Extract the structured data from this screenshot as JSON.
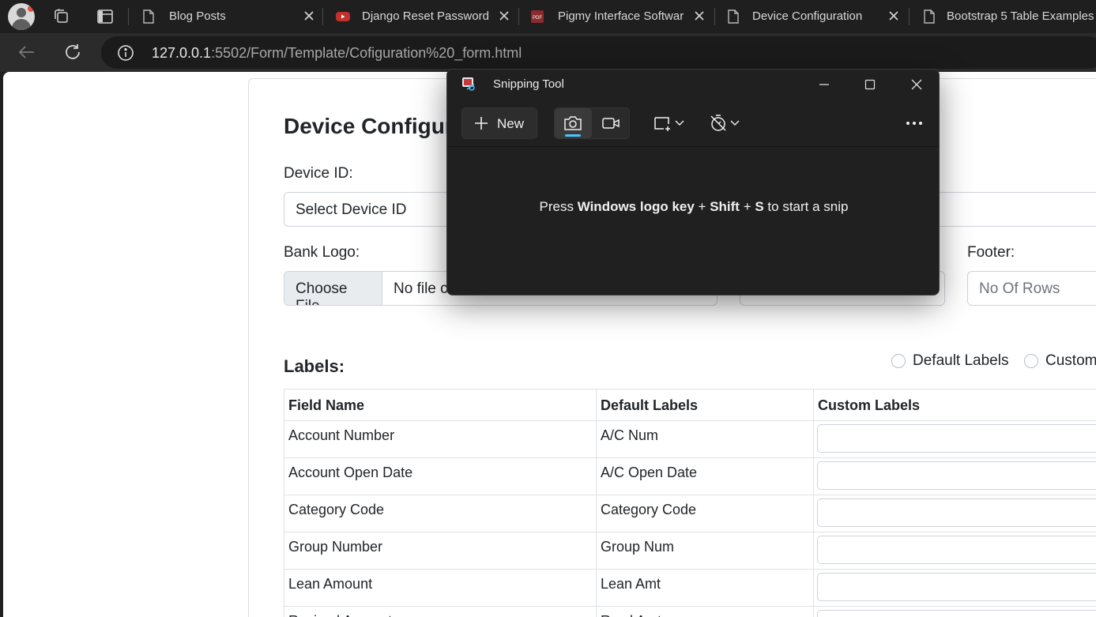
{
  "tabs": [
    {
      "title": "Blog Posts",
      "icon": "document-icon"
    },
    {
      "title": "Django Reset Password",
      "icon": "youtube-icon"
    },
    {
      "title": "Pigmy Interface Software",
      "icon": "pdf-icon"
    },
    {
      "title": "Device Configuration",
      "icon": "document-icon"
    },
    {
      "title": "Bootstrap 5 Table Examples",
      "icon": "document-icon"
    }
  ],
  "address": {
    "host": "127.0.0.1",
    "rest": ":5502/Form/Template/Cofiguration%20_form.html"
  },
  "form": {
    "heading": "Device Configur",
    "device_id_label": "Device ID:",
    "device_id_value": "Select Device ID",
    "bank_logo_label": "Bank Logo:",
    "choose_file": "Choose File",
    "no_file": "No file c",
    "footer_label": "Footer:",
    "rows_placeholder": "No Of Rows",
    "labels_heading": "Labels:",
    "radio_default": "Default Labels",
    "radio_custom": "Custom"
  },
  "table": {
    "headers": [
      "Field Name",
      "Default Labels",
      "Custom Labels"
    ],
    "rows": [
      {
        "field": "Account Number",
        "default": "A/C Num"
      },
      {
        "field": "Account Open Date",
        "default": "A/C Open Date"
      },
      {
        "field": "Category Code",
        "default": "Category Code"
      },
      {
        "field": "Group Number",
        "default": "Group Num"
      },
      {
        "field": "Lean Amount",
        "default": "Lean Amt"
      },
      {
        "field": "Recived Amount",
        "default": "Rcvd Amt"
      }
    ]
  },
  "snip": {
    "title": "Snipping Tool",
    "new_label": "New",
    "hint_pre": "Press ",
    "hint_keys1": "Windows logo key",
    "hint_plus1": " + ",
    "hint_keys2": "Shift",
    "hint_plus2": " + ",
    "hint_keys3": "S",
    "hint_post": " to start a snip",
    "accent": "#4cc2ff"
  }
}
